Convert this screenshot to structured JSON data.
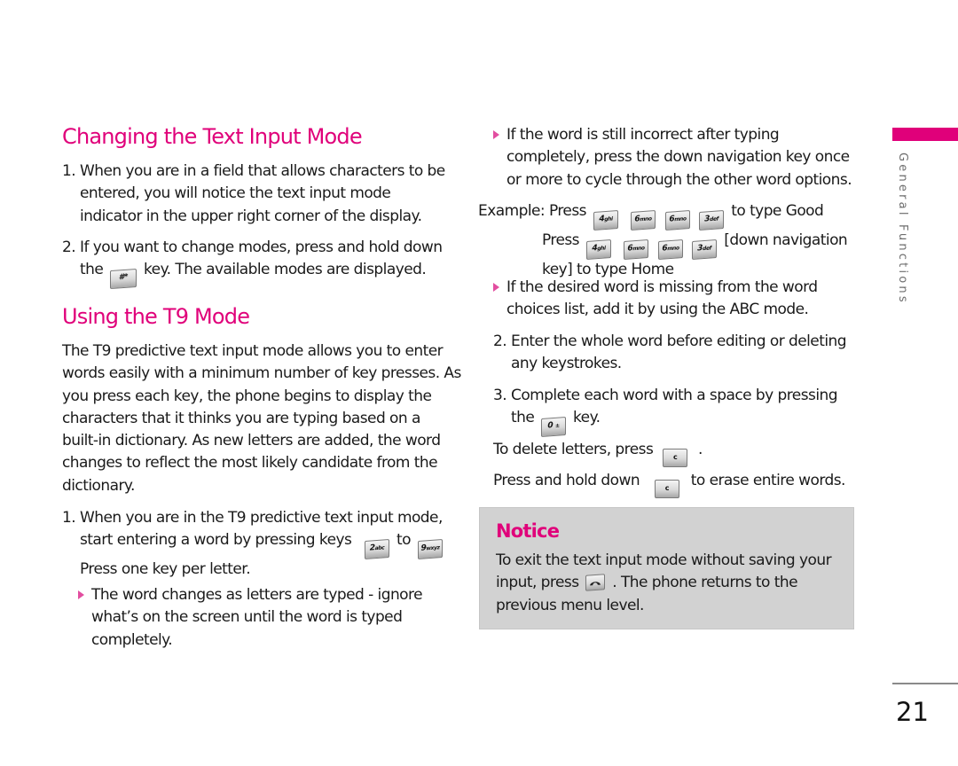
{
  "accent_color": "#e0007a",
  "notice_bg_color": "#d2d2d2",
  "section_tab": {
    "label": "General Functions"
  },
  "page_number": "21",
  "left_column": {
    "changing_mode": {
      "heading": "Changing the Text Input Mode",
      "steps": [
        {
          "number": "1.",
          "lines": [
            "When you are in a field that allows characters to be",
            "entered, you will notice the text input mode",
            "indicator in the upper right corner of the display."
          ]
        },
        {
          "number": "2.",
          "line1": "If you want to change modes, press and hold down",
          "line2_before": "the",
          "line2_key": "#*",
          "line2_after": "key. The available modes are displayed."
        }
      ]
    },
    "t9_mode": {
      "heading": "Using the T9 Mode",
      "intro_lines": [
        "The T9 predictive text input mode allows you to enter",
        "words easily with a minimum number of key presses. As",
        "you press each key, the phone begins to display the",
        "characters that it thinks you are typing based on a",
        "built-in dictionary. As new letters are added, the word",
        "changes to reflect the most likely candidate from the",
        "dictionary."
      ],
      "step1": {
        "number": "1.",
        "line1": "When you are in the T9 predictive text input mode,",
        "line2_before": "start entering a word by pressing keys",
        "key_from": {
          "digit": "2",
          "letters": "abc"
        },
        "line2_middle": "to",
        "key_to": {
          "digit": "9",
          "letters": "wxyz"
        },
        "line3": "Press one key per letter."
      },
      "bullet1_lines": [
        "The word changes as letters are typed - ignore",
        "what’s on the screen until the word is typed",
        "completely."
      ]
    }
  },
  "right_column": {
    "bullet2_lines": [
      "If the word is still incorrect after typing",
      "completely, press the down navigation key once",
      "or more to cycle through the other word options."
    ],
    "example": {
      "label": "Example:",
      "press_label": "Press",
      "keys": [
        {
          "digit": "4",
          "letters": "ghi"
        },
        {
          "digit": "6",
          "letters": "mno"
        },
        {
          "digit": "6",
          "letters": "mno"
        },
        {
          "digit": "3",
          "letters": "def"
        }
      ],
      "line1_after": "to type Good",
      "line2_after": "[down navigation",
      "line3": "key] to type Home"
    },
    "bullet3_lines": [
      "If the desired word is missing from the word",
      "choices list, add it by using the ABC mode."
    ],
    "step2": {
      "number": "2.",
      "lines": [
        "Enter the whole word before editing or deleting",
        "any keystrokes."
      ]
    },
    "step3": {
      "number": "3.",
      "line1": "Complete each word with a space by pressing",
      "line2_before": "the",
      "key": {
        "digit": "0",
        "letters": "±"
      },
      "line2_after": "key."
    },
    "delete_letters": {
      "before": "To delete letters, press",
      "key": "c",
      "after": "."
    },
    "erase_words": {
      "before": "Press and hold down",
      "key": "c",
      "after": "to erase entire words."
    },
    "notice": {
      "title": "Notice",
      "line1": "To exit the text input mode without saving your",
      "line2_before": "input, press",
      "line2_key_icon": "end-call-key-icon",
      "line2_after": ". The phone returns to the",
      "line3": "previous menu level."
    }
  }
}
